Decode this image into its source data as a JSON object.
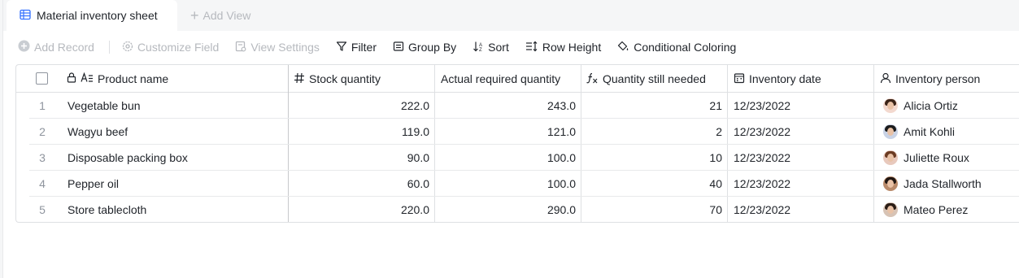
{
  "tabs": {
    "active_label": "Material inventory sheet",
    "add_view_label": "Add View"
  },
  "toolbar": {
    "add_record": "Add Record",
    "customize_field": "Customize Field",
    "view_settings": "View Settings",
    "filter": "Filter",
    "group_by": "Group By",
    "sort": "Sort",
    "row_height": "Row Height",
    "conditional_coloring": "Conditional Coloring"
  },
  "columns": {
    "product_name": "Product name",
    "stock_quantity": "Stock quantity",
    "actual_required_quantity": "Actual required quantity",
    "quantity_still_needed": "Quantity still needed",
    "inventory_date": "Inventory date",
    "inventory_person": "Inventory person"
  },
  "rows": [
    {
      "index": "1",
      "product": "Vegetable bun",
      "stock": "222.0",
      "required": "243.0",
      "needed": "21",
      "date": "12/23/2022",
      "person": "Alicia Ortiz",
      "avatar_hair": "#3b2418",
      "avatar_bg": "#f3d9cf"
    },
    {
      "index": "2",
      "product": "Wagyu beef",
      "stock": "119.0",
      "required": "121.0",
      "needed": "2",
      "date": "12/23/2022",
      "person": "Amit Kohli",
      "avatar_hair": "#1c1c1c",
      "avatar_bg": "#c9d3e6"
    },
    {
      "index": "3",
      "product": "Disposable packing box",
      "stock": "90.0",
      "required": "100.0",
      "needed": "10",
      "date": "12/23/2022",
      "person": "Juliette Roux",
      "avatar_hair": "#6b3b22",
      "avatar_bg": "#e8c9bd"
    },
    {
      "index": "4",
      "product": "Pepper oil",
      "stock": "60.0",
      "required": "100.0",
      "needed": "40",
      "date": "12/23/2022",
      "person": "Jada Stallworth",
      "avatar_hair": "#201612",
      "avatar_bg": "#b98a6a"
    },
    {
      "index": "5",
      "product": "Store tablecloth",
      "stock": "220.0",
      "required": "290.0",
      "needed": "70",
      "date": "12/23/2022",
      "person": "Mateo Perez",
      "avatar_hair": "#2a1d16",
      "avatar_bg": "#d7c3b5"
    }
  ],
  "colors": {
    "accent": "#3370ff",
    "text": "#1f2329",
    "disabled": "#b6b9be",
    "border": "#dee0e3"
  }
}
